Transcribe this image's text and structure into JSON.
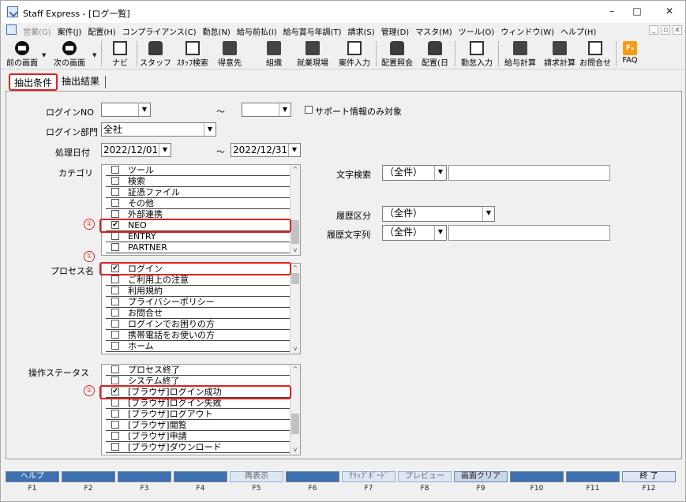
{
  "window": {
    "title": "Staff Express - [ログ一覧]",
    "controls": [
      "–",
      "□",
      "✕"
    ]
  },
  "menu": {
    "items": [
      {
        "label": "営業(G)",
        "disabled": true
      },
      {
        "label": "案件(J)"
      },
      {
        "label": "配置(H)"
      },
      {
        "label": "コンプライアンス(C)"
      },
      {
        "label": "勤怠(N)"
      },
      {
        "label": "給与前払(I)"
      },
      {
        "label": "給与賞与年調(T)"
      },
      {
        "label": "請求(S)"
      },
      {
        "label": "管理(D)"
      },
      {
        "label": "マスタ(M)"
      },
      {
        "label": "ツール(O)"
      },
      {
        "label": "ウィンドウ(W)"
      },
      {
        "label": "ヘルプ(H)"
      }
    ],
    "mdi_controls": [
      "_",
      "▫",
      "x"
    ]
  },
  "toolbar": {
    "back": "前の画面",
    "forward": "次の画面",
    "navi": "ナビ",
    "staff": "スタッフ",
    "staff_search": "ｽﾀｯﾌ検索",
    "client": "得意先",
    "org": "組織",
    "site": "就業現場",
    "job_input": "案件入力",
    "assign_ref": "配置照会",
    "assign_day": "配置(日",
    "attendance": "勤怠入力",
    "payroll": "給与計算",
    "billing": "請求計算",
    "inquiry": "お問合せ",
    "faq": "FAQ",
    "faq_badge": "Fₐ"
  },
  "tabs": {
    "conditions": "抽出条件",
    "results": "抽出結果"
  },
  "form": {
    "login_no_label": "ログインNO",
    "login_no_from": "",
    "login_no_to": "",
    "range_sep": "～",
    "support_only_label": "サポート情報のみ対象",
    "dept_label": "ログイン部門",
    "dept_value": "全社",
    "date_label": "処理日付",
    "date_from": "2022/12/01",
    "date_to": "2022/12/31",
    "category_label": "カテゴリ",
    "process_label": "プロセス名",
    "status_label": "操作ステータス",
    "text_search_label": "文字検索",
    "text_search_value": "（全件）",
    "history_type_label": "履歴区分",
    "history_type_value": "（全件）",
    "history_text_label": "履歴文字列",
    "history_text_value": "（全件）"
  },
  "category_items": [
    {
      "label": "ツール",
      "checked": false
    },
    {
      "label": "検索",
      "checked": false
    },
    {
      "label": "証憑ファイル",
      "checked": false
    },
    {
      "label": "その他",
      "checked": false
    },
    {
      "label": "外部連携",
      "checked": false
    },
    {
      "label": "NEO",
      "checked": true
    },
    {
      "label": "ENTRY",
      "checked": false
    },
    {
      "label": "PARTNER",
      "checked": false
    }
  ],
  "process_items": [
    {
      "label": "ログイン",
      "checked": true
    },
    {
      "label": "ご利用上の注意",
      "checked": false
    },
    {
      "label": "利用規約",
      "checked": false
    },
    {
      "label": "プライバシーポリシー",
      "checked": false
    },
    {
      "label": "お問合せ",
      "checked": false
    },
    {
      "label": "ログインでお困りの方",
      "checked": false
    },
    {
      "label": "携帯電話をお使いの方",
      "checked": false
    },
    {
      "label": "ホーム",
      "checked": false
    }
  ],
  "status_items": [
    {
      "label": "プロセス終了",
      "checked": false
    },
    {
      "label": "システム終了",
      "checked": false
    },
    {
      "label": "[ブラウザ]ログイン成功",
      "checked": true
    },
    {
      "label": "[ブラウザ]ログイン失敗",
      "checked": false
    },
    {
      "label": "[ブラウザ]ログアウト",
      "checked": false
    },
    {
      "label": "[ブラウザ]閲覧",
      "checked": false
    },
    {
      "label": "[ブラウザ]申請",
      "checked": false
    },
    {
      "label": "[ブラウザ]ダウンロード",
      "checked": false
    }
  ],
  "annotation_marker": "①",
  "fkeys": [
    {
      "label": "ヘルプ",
      "key": "F1"
    },
    {
      "label": "",
      "key": "F2"
    },
    {
      "label": "",
      "key": "F3"
    },
    {
      "label": "",
      "key": "F4"
    },
    {
      "label": "再表示",
      "key": "F5"
    },
    {
      "label": "",
      "key": "F6"
    },
    {
      "label": "ｸﾘｯﾌﾟﾎﾞｰﾄﾞ",
      "key": "F7"
    },
    {
      "label": "プレビュー",
      "key": "F8"
    },
    {
      "label": "画面クリア",
      "key": "F9"
    },
    {
      "label": "",
      "key": "F10"
    },
    {
      "label": "",
      "key": "F11"
    },
    {
      "label": "終 了",
      "key": "F12"
    }
  ]
}
